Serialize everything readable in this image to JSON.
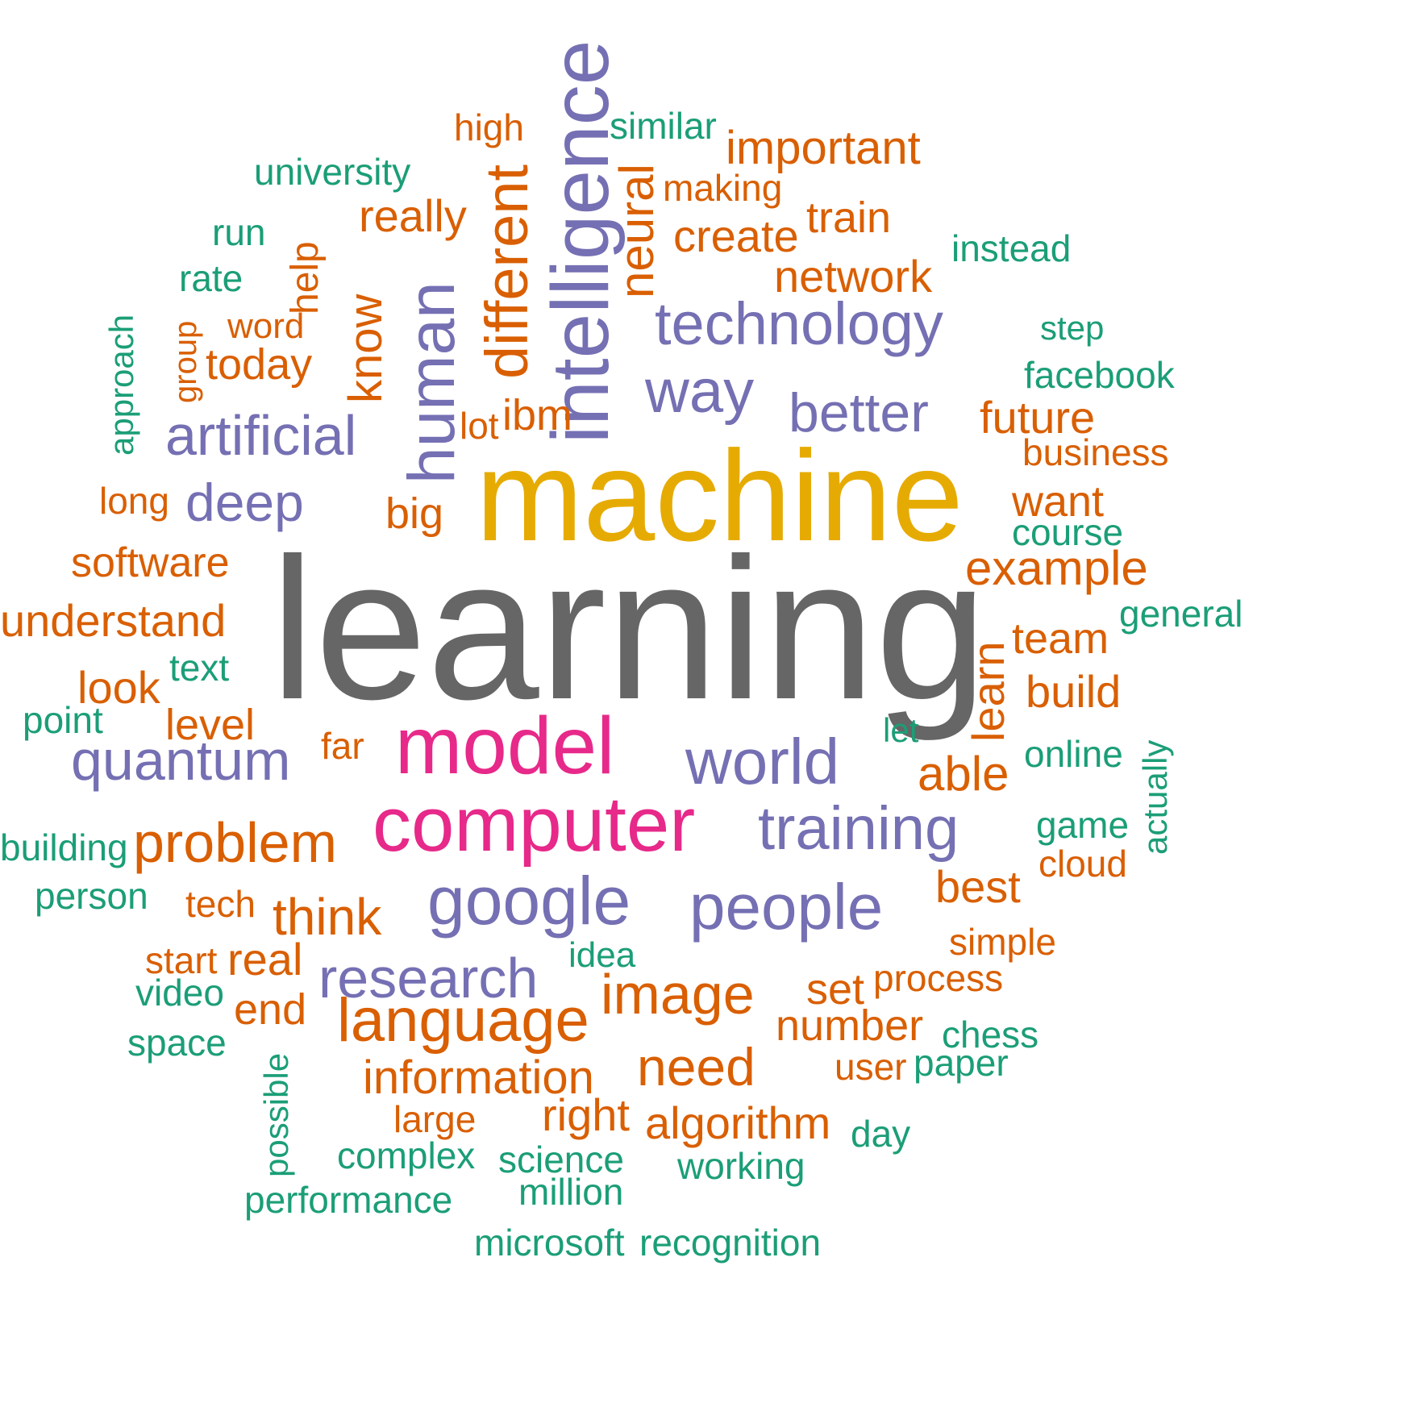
{
  "colors": {
    "gray": "#666666",
    "gold": "#e6ab02",
    "pink": "#e7298a",
    "purple": "#7570b3",
    "orange": "#d95f02",
    "green": "#1b9e77"
  },
  "words": [
    {
      "text": "learning",
      "color": "gray"
    },
    {
      "text": "machine",
      "color": "gold"
    },
    {
      "text": "model",
      "color": "pink"
    },
    {
      "text": "computer",
      "color": "pink"
    },
    {
      "text": "intelligence",
      "color": "purple"
    },
    {
      "text": "human",
      "color": "purple"
    },
    {
      "text": "technology",
      "color": "purple"
    },
    {
      "text": "way",
      "color": "purple"
    },
    {
      "text": "better",
      "color": "purple"
    },
    {
      "text": "artificial",
      "color": "purple"
    },
    {
      "text": "deep",
      "color": "purple"
    },
    {
      "text": "quantum",
      "color": "purple"
    },
    {
      "text": "world",
      "color": "purple"
    },
    {
      "text": "training",
      "color": "purple"
    },
    {
      "text": "google",
      "color": "purple"
    },
    {
      "text": "people",
      "color": "purple"
    },
    {
      "text": "research",
      "color": "purple"
    },
    {
      "text": "different",
      "color": "orange"
    },
    {
      "text": "neural",
      "color": "orange"
    },
    {
      "text": "know",
      "color": "orange"
    },
    {
      "text": "help",
      "color": "orange"
    },
    {
      "text": "group",
      "color": "orange"
    },
    {
      "text": "learn",
      "color": "orange"
    },
    {
      "text": "approach",
      "color": "green"
    },
    {
      "text": "possible",
      "color": "green"
    },
    {
      "text": "actually",
      "color": "green"
    },
    {
      "text": "high",
      "color": "orange"
    },
    {
      "text": "similar",
      "color": "green"
    },
    {
      "text": "important",
      "color": "orange"
    },
    {
      "text": "university",
      "color": "green"
    },
    {
      "text": "making",
      "color": "orange"
    },
    {
      "text": "really",
      "color": "orange"
    },
    {
      "text": "train",
      "color": "orange"
    },
    {
      "text": "run",
      "color": "green"
    },
    {
      "text": "create",
      "color": "orange"
    },
    {
      "text": "instead",
      "color": "green"
    },
    {
      "text": "rate",
      "color": "green"
    },
    {
      "text": "network",
      "color": "orange"
    },
    {
      "text": "word",
      "color": "orange"
    },
    {
      "text": "step",
      "color": "green"
    },
    {
      "text": "today",
      "color": "orange"
    },
    {
      "text": "facebook",
      "color": "green"
    },
    {
      "text": "ibm",
      "color": "orange"
    },
    {
      "text": "lot",
      "color": "orange"
    },
    {
      "text": "future",
      "color": "orange"
    },
    {
      "text": "business",
      "color": "orange"
    },
    {
      "text": "long",
      "color": "orange"
    },
    {
      "text": "big",
      "color": "orange"
    },
    {
      "text": "want",
      "color": "orange"
    },
    {
      "text": "course",
      "color": "green"
    },
    {
      "text": "software",
      "color": "orange"
    },
    {
      "text": "example",
      "color": "orange"
    },
    {
      "text": "understand",
      "color": "orange"
    },
    {
      "text": "general",
      "color": "green"
    },
    {
      "text": "team",
      "color": "orange"
    },
    {
      "text": "text",
      "color": "green"
    },
    {
      "text": "look",
      "color": "orange"
    },
    {
      "text": "build",
      "color": "orange"
    },
    {
      "text": "point",
      "color": "green"
    },
    {
      "text": "level",
      "color": "orange"
    },
    {
      "text": "far",
      "color": "orange"
    },
    {
      "text": "let",
      "color": "green"
    },
    {
      "text": "online",
      "color": "green"
    },
    {
      "text": "able",
      "color": "orange"
    },
    {
      "text": "building",
      "color": "green"
    },
    {
      "text": "problem",
      "color": "orange"
    },
    {
      "text": "game",
      "color": "green"
    },
    {
      "text": "cloud",
      "color": "orange"
    },
    {
      "text": "person",
      "color": "green"
    },
    {
      "text": "tech",
      "color": "orange"
    },
    {
      "text": "think",
      "color": "orange"
    },
    {
      "text": "best",
      "color": "orange"
    },
    {
      "text": "simple",
      "color": "orange"
    },
    {
      "text": "start",
      "color": "orange"
    },
    {
      "text": "real",
      "color": "orange"
    },
    {
      "text": "idea",
      "color": "green"
    },
    {
      "text": "video",
      "color": "green"
    },
    {
      "text": "image",
      "color": "orange"
    },
    {
      "text": "set",
      "color": "orange"
    },
    {
      "text": "process",
      "color": "orange"
    },
    {
      "text": "end",
      "color": "orange"
    },
    {
      "text": "language",
      "color": "orange"
    },
    {
      "text": "number",
      "color": "orange"
    },
    {
      "text": "chess",
      "color": "green"
    },
    {
      "text": "space",
      "color": "green"
    },
    {
      "text": "user",
      "color": "orange"
    },
    {
      "text": "paper",
      "color": "green"
    },
    {
      "text": "information",
      "color": "orange"
    },
    {
      "text": "need",
      "color": "orange"
    },
    {
      "text": "large",
      "color": "orange"
    },
    {
      "text": "right",
      "color": "orange"
    },
    {
      "text": "algorithm",
      "color": "orange"
    },
    {
      "text": "day",
      "color": "green"
    },
    {
      "text": "complex",
      "color": "green"
    },
    {
      "text": "science",
      "color": "green"
    },
    {
      "text": "working",
      "color": "green"
    },
    {
      "text": "million",
      "color": "green"
    },
    {
      "text": "performance",
      "color": "green"
    },
    {
      "text": "microsoft",
      "color": "green"
    },
    {
      "text": "recognition",
      "color": "green"
    }
  ]
}
